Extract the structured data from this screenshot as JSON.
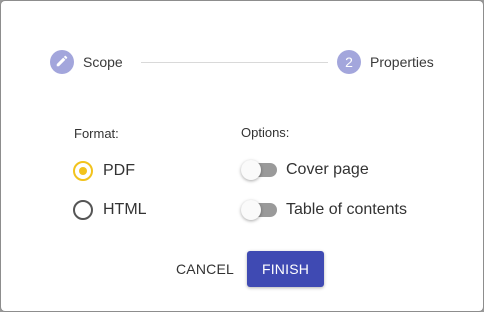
{
  "stepper": {
    "steps": [
      {
        "icon": "pencil-icon",
        "number": "",
        "label": "Scope"
      },
      {
        "icon": "",
        "number": "2",
        "label": "Properties"
      }
    ]
  },
  "format": {
    "label": "Format:",
    "options": [
      {
        "label": "PDF",
        "checked": true
      },
      {
        "label": "HTML",
        "checked": false
      }
    ]
  },
  "options": {
    "label": "Options:",
    "toggles": [
      {
        "label": "Cover page",
        "on": false
      },
      {
        "label": "Table of contents",
        "on": false
      }
    ]
  },
  "actions": {
    "cancel_label": "CANCEL",
    "finish_label": "FINISH"
  },
  "colors": {
    "accent": "#3f4ab3",
    "step_circle": "#a3a6dc",
    "radio_selected": "#f2c31d"
  }
}
